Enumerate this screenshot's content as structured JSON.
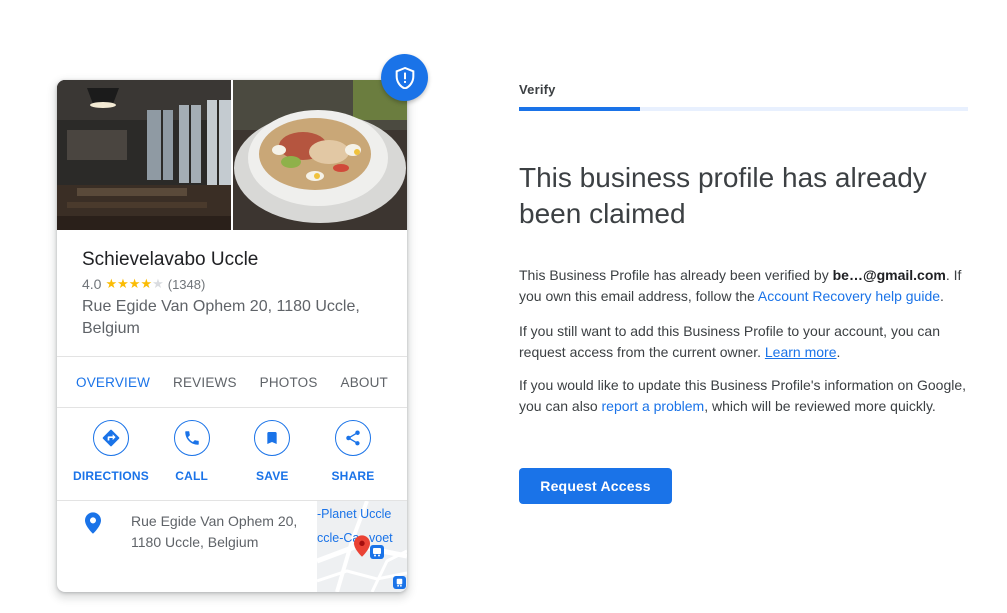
{
  "card": {
    "business_name": "Schievelavabo Uccle",
    "rating": "4.0",
    "rating_stars": 4,
    "rating_max": 5,
    "review_count": "(1348)",
    "address_main": "Rue Egide Van Ophem 20, 1180 Uccle, Belgium",
    "tabs": [
      {
        "label": "OVERVIEW",
        "active": true
      },
      {
        "label": "REVIEWS",
        "active": false
      },
      {
        "label": "PHOTOS",
        "active": false
      },
      {
        "label": "ABOUT",
        "active": false
      }
    ],
    "actions": [
      {
        "label": "DIRECTIONS",
        "icon": "directions-icon"
      },
      {
        "label": "CALL",
        "icon": "phone-icon"
      },
      {
        "label": "SAVE",
        "icon": "bookmark-icon"
      },
      {
        "label": "SHARE",
        "icon": "share-icon"
      }
    ],
    "address_line_1": "Rue Egide Van Ophem 20,",
    "address_line_2": "1180 Uccle, Belgium",
    "map_labels": {
      "top": "-Planet Uccle",
      "middle_1": "ccle-Ca",
      "middle_2": "voet"
    },
    "badge_icon": "shield-icon"
  },
  "verify": {
    "step_label": "Verify",
    "progress": 0.27,
    "heading": "This business profile has already been claimed",
    "para1_text_1": "This Business Profile has already been verified by ",
    "para1_email": "be…@gmail.com",
    "para1_text_2": ". If you own this email address, follow the ",
    "para1_link": "Account Recovery help guide",
    "para1_text_3": ".",
    "para2_text_1": "If you still want to add this Business Profile to your account, you can request access from the current owner. ",
    "para2_link": "Learn more",
    "para2_text_2": ".",
    "para3_text_1": "If you would like to update this Business Profile's information on Google, you can also ",
    "para3_link": "report a problem",
    "para3_text_2": ", which will be reviewed more quickly.",
    "button_label": "Request Access"
  },
  "colors": {
    "accent": "#1a73e8",
    "star": "#fbbc04",
    "progress_track": "#e8f0fe",
    "map_pin": "#ea4335"
  }
}
